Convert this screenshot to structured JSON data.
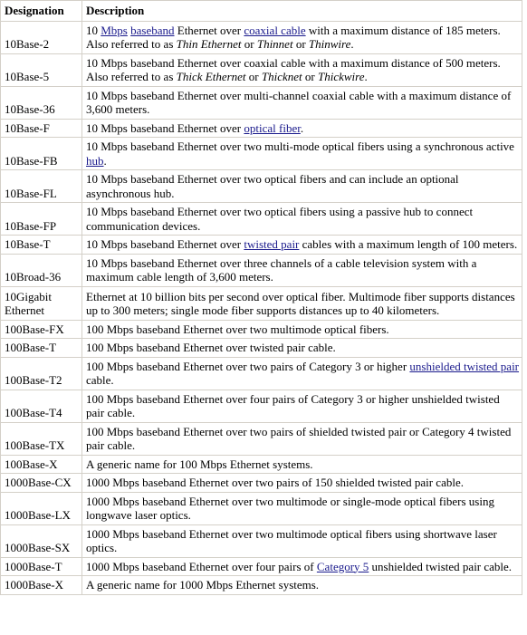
{
  "table": {
    "columns": [
      {
        "key": "designation",
        "header": "Designation"
      },
      {
        "key": "description",
        "header": "Description"
      }
    ],
    "link_color": "#1a1a8c",
    "border_color": "#d4d0c8",
    "rows": [
      {
        "designation": "10Base-2",
        "description": "10 Mbps baseband Ethernet over coaxial cable with a maximum distance of 185 meters. Also referred to as Thin Ethernet or Thinnet or Thinwire.",
        "parts": [
          {
            "t": "10 ",
            "s": "plain"
          },
          {
            "t": "Mbps",
            "s": "link"
          },
          {
            "t": " ",
            "s": "plain"
          },
          {
            "t": "baseband",
            "s": "link"
          },
          {
            "t": " Ethernet over ",
            "s": "plain"
          },
          {
            "t": "coaxial cable",
            "s": "link"
          },
          {
            "t": " with a maximum distance of 185 meters. Also referred to as ",
            "s": "plain"
          },
          {
            "t": "Thin Ethernet",
            "s": "italic"
          },
          {
            "t": " or ",
            "s": "plain"
          },
          {
            "t": "Thinnet",
            "s": "italic"
          },
          {
            "t": " or ",
            "s": "plain"
          },
          {
            "t": "Thinwire",
            "s": "italic"
          },
          {
            "t": ".",
            "s": "plain"
          }
        ]
      },
      {
        "designation": "10Base-5",
        "description": "10 Mbps baseband Ethernet over coaxial cable with a maximum distance of 500 meters. Also referred to as Thick Ethernet or Thicknet or Thickwire.",
        "parts": [
          {
            "t": "10 Mbps baseband Ethernet over coaxial cable with a maximum distance of 500 meters. Also referred to as ",
            "s": "plain"
          },
          {
            "t": "Thick Ethernet",
            "s": "italic"
          },
          {
            "t": " or ",
            "s": "plain"
          },
          {
            "t": "Thicknet",
            "s": "italic"
          },
          {
            "t": " or ",
            "s": "plain"
          },
          {
            "t": "Thickwire",
            "s": "italic"
          },
          {
            "t": ".",
            "s": "plain"
          }
        ]
      },
      {
        "designation": "10Base-36",
        "description": "10 Mbps baseband Ethernet over multi-channel coaxial cable with a maximum distance of 3,600 meters.",
        "parts": [
          {
            "t": "10 Mbps baseband Ethernet over multi-channel coaxial cable with a maximum distance of 3,600 meters.",
            "s": "plain"
          }
        ]
      },
      {
        "designation": "10Base-F",
        "description": "10 Mbps baseband Ethernet over optical fiber.",
        "parts": [
          {
            "t": "10 Mbps baseband Ethernet over ",
            "s": "plain"
          },
          {
            "t": "optical fiber",
            "s": "link"
          },
          {
            "t": ".",
            "s": "plain"
          }
        ]
      },
      {
        "designation": "10Base-FB",
        "description": "10 Mbps baseband Ethernet over two multi-mode optical fibers using a synchronous active hub.",
        "parts": [
          {
            "t": "10 Mbps baseband Ethernet over two multi-mode optical fibers using a synchronous active ",
            "s": "plain"
          },
          {
            "t": "hub",
            "s": "link"
          },
          {
            "t": ".",
            "s": "plain"
          }
        ]
      },
      {
        "designation": "10Base-FL",
        "description": "10 Mbps baseband Ethernet over two optical fibers and can include an optional asynchronous hub.",
        "parts": [
          {
            "t": "10 Mbps baseband Ethernet over two optical fibers and can include an optional asynchronous hub.",
            "s": "plain"
          }
        ]
      },
      {
        "designation": "10Base-FP",
        "description": "10 Mbps baseband Ethernet over two optical fibers using a passive hub to connect communication devices.",
        "parts": [
          {
            "t": "10 Mbps baseband Ethernet over two optical fibers using a passive hub to connect communication devices.",
            "s": "plain"
          }
        ]
      },
      {
        "designation": "10Base-T",
        "description": "10 Mbps baseband Ethernet over twisted pair cables with a maximum length of 100 meters.",
        "parts": [
          {
            "t": "10 Mbps baseband Ethernet over ",
            "s": "plain"
          },
          {
            "t": "twisted pair",
            "s": "link"
          },
          {
            "t": " cables with a maximum length of 100 meters.",
            "s": "plain"
          }
        ]
      },
      {
        "designation": "10Broad-36",
        "description": "10 Mbps baseband Ethernet over three channels of a cable television system with a maximum cable length of 3,600 meters.",
        "parts": [
          {
            "t": "10 Mbps baseband Ethernet over three channels of a cable television system with a maximum cable length of 3,600 meters.",
            "s": "plain"
          }
        ]
      },
      {
        "designation": "10Gigabit Ethernet",
        "designation_wrap": true,
        "description": "Ethernet at 10 billion bits per second over optical fiber. Multimode fiber supports distances up to 300 meters; single mode fiber supports distances up to 40 kilometers.",
        "parts": [
          {
            "t": "Ethernet at 10 billion bits per second over optical fiber. Multimode fiber supports distances up to 300 meters; single mode fiber supports distances up to 40 kilometers.",
            "s": "plain"
          }
        ]
      },
      {
        "designation": "100Base-FX",
        "description": "100 Mbps baseband Ethernet over two multimode optical fibers.",
        "parts": [
          {
            "t": "100 Mbps baseband Ethernet over two multimode optical fibers.",
            "s": "plain"
          }
        ]
      },
      {
        "designation": "100Base-T",
        "description": "100 Mbps baseband Ethernet over twisted pair cable.",
        "parts": [
          {
            "t": "100 Mbps baseband Ethernet over twisted pair cable.",
            "s": "plain"
          }
        ]
      },
      {
        "designation": "100Base-T2",
        "description": "100 Mbps baseband Ethernet over two pairs of Category 3 or higher unshielded twisted pair cable.",
        "parts": [
          {
            "t": "100 Mbps baseband Ethernet over two pairs of Category 3 or higher ",
            "s": "plain"
          },
          {
            "t": "unshielded twisted pair",
            "s": "link"
          },
          {
            "t": " cable.",
            "s": "plain"
          }
        ]
      },
      {
        "designation": "100Base-T4",
        "description": "100 Mbps baseband Ethernet over four pairs of Category 3 or higher unshielded twisted pair cable.",
        "parts": [
          {
            "t": "100 Mbps baseband Ethernet over four pairs of Category 3 or higher unshielded twisted pair cable.",
            "s": "plain"
          }
        ]
      },
      {
        "designation": "100Base-TX",
        "description": "100 Mbps baseband Ethernet over two pairs of shielded twisted pair or Category 4 twisted pair cable.",
        "parts": [
          {
            "t": "100 Mbps baseband Ethernet over two pairs of shielded twisted pair or Category 4 twisted pair cable.",
            "s": "plain"
          }
        ]
      },
      {
        "designation": "100Base-X",
        "description": "A generic name for 100 Mbps Ethernet systems.",
        "parts": [
          {
            "t": "A generic name for 100 Mbps Ethernet systems.",
            "s": "plain"
          }
        ]
      },
      {
        "designation": "1000Base-CX",
        "description": "1000 Mbps baseband Ethernet over two pairs of 150 shielded twisted pair cable.",
        "parts": [
          {
            "t": "1000 Mbps baseband Ethernet over two pairs of 150 shielded twisted pair cable.",
            "s": "plain"
          }
        ]
      },
      {
        "designation": "1000Base-LX",
        "description": "1000 Mbps baseband Ethernet over two multimode or single-mode optical fibers using longwave laser optics.",
        "parts": [
          {
            "t": "1000 Mbps baseband Ethernet over two multimode or single-mode optical fibers using longwave laser optics.",
            "s": "plain"
          }
        ]
      },
      {
        "designation": "1000Base-SX",
        "description": "1000 Mbps baseband Ethernet over two multimode optical fibers using shortwave laser optics.",
        "parts": [
          {
            "t": "1000 Mbps baseband Ethernet over two multimode optical fibers using shortwave laser optics.",
            "s": "plain"
          }
        ]
      },
      {
        "designation": "1000Base-T",
        "description": "1000 Mbps baseband Ethernet over four pairs of Category 5 unshielded twisted pair cable.",
        "parts": [
          {
            "t": "1000 Mbps baseband Ethernet over four pairs of ",
            "s": "plain"
          },
          {
            "t": "Category 5",
            "s": "link"
          },
          {
            "t": " unshielded twisted pair cable.",
            "s": "plain"
          }
        ]
      },
      {
        "designation": "1000Base-X",
        "description": "A generic name for 1000 Mbps Ethernet systems.",
        "parts": [
          {
            "t": "A generic name for 1000 Mbps Ethernet systems.",
            "s": "plain"
          }
        ]
      }
    ]
  }
}
